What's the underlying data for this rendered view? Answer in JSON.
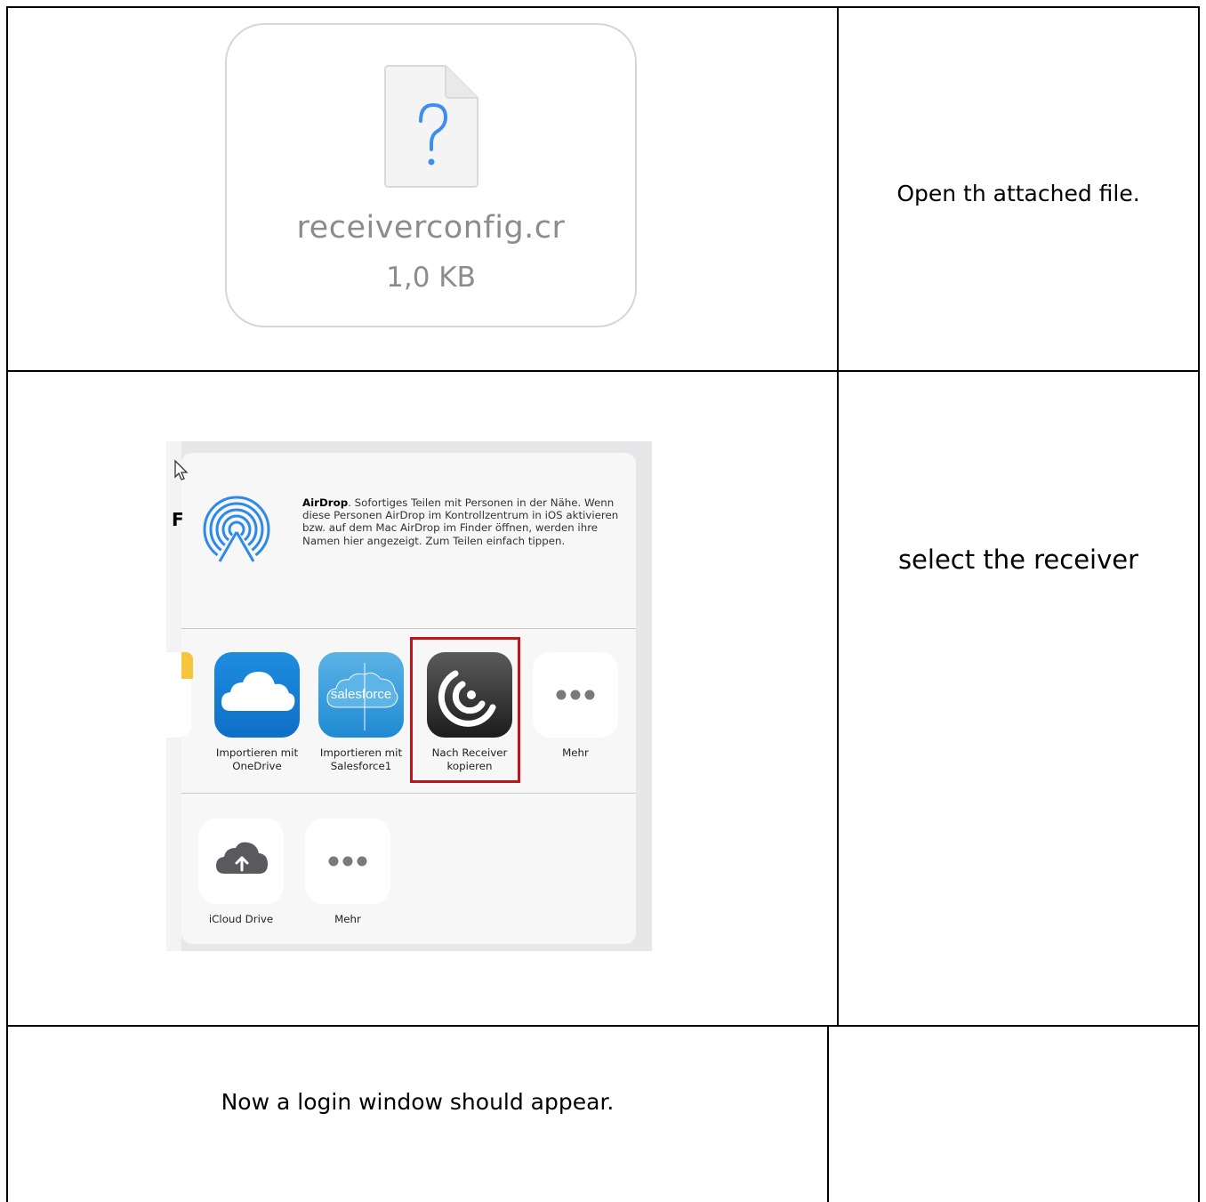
{
  "rows": [
    {
      "file": {
        "name": "receiverconfig.cr",
        "size": "1,0 KB",
        "icon": "question-document-icon"
      },
      "instruction": "Open th attached file."
    },
    {
      "share_sheet": {
        "airdrop": {
          "title": "AirDrop",
          "description": ". Sofortiges Teilen mit Personen in der Nähe. Wenn diese Personen AirDrop im Kontrollzentrum in iOS aktivieren bzw. auf dem Mac AirDrop im Finder öffnen, werden ihre Namen hier angezeigt. Zum Teilen einfach tippen."
        },
        "partial_left_letter": "F",
        "apps": [
          {
            "label": "Importieren mit OneDrive",
            "icon": "onedrive-cloud-icon"
          },
          {
            "label": "Importieren mit Salesforce1",
            "icon": "salesforce-cloud-icon",
            "brand": "salesforce"
          },
          {
            "label": "Nach Receiver kopieren",
            "icon": "receiver-signal-icon",
            "highlighted": true
          },
          {
            "label": "Mehr",
            "icon": "more-dots-icon"
          }
        ],
        "actions": [
          {
            "label": "iCloud Drive",
            "icon": "icloud-upload-icon"
          },
          {
            "label": "Mehr",
            "icon": "more-dots-icon"
          }
        ],
        "highlight_color": "#c0161b"
      },
      "instruction": "select the receiver"
    },
    {
      "instruction": "Now a login window should appear."
    }
  ]
}
